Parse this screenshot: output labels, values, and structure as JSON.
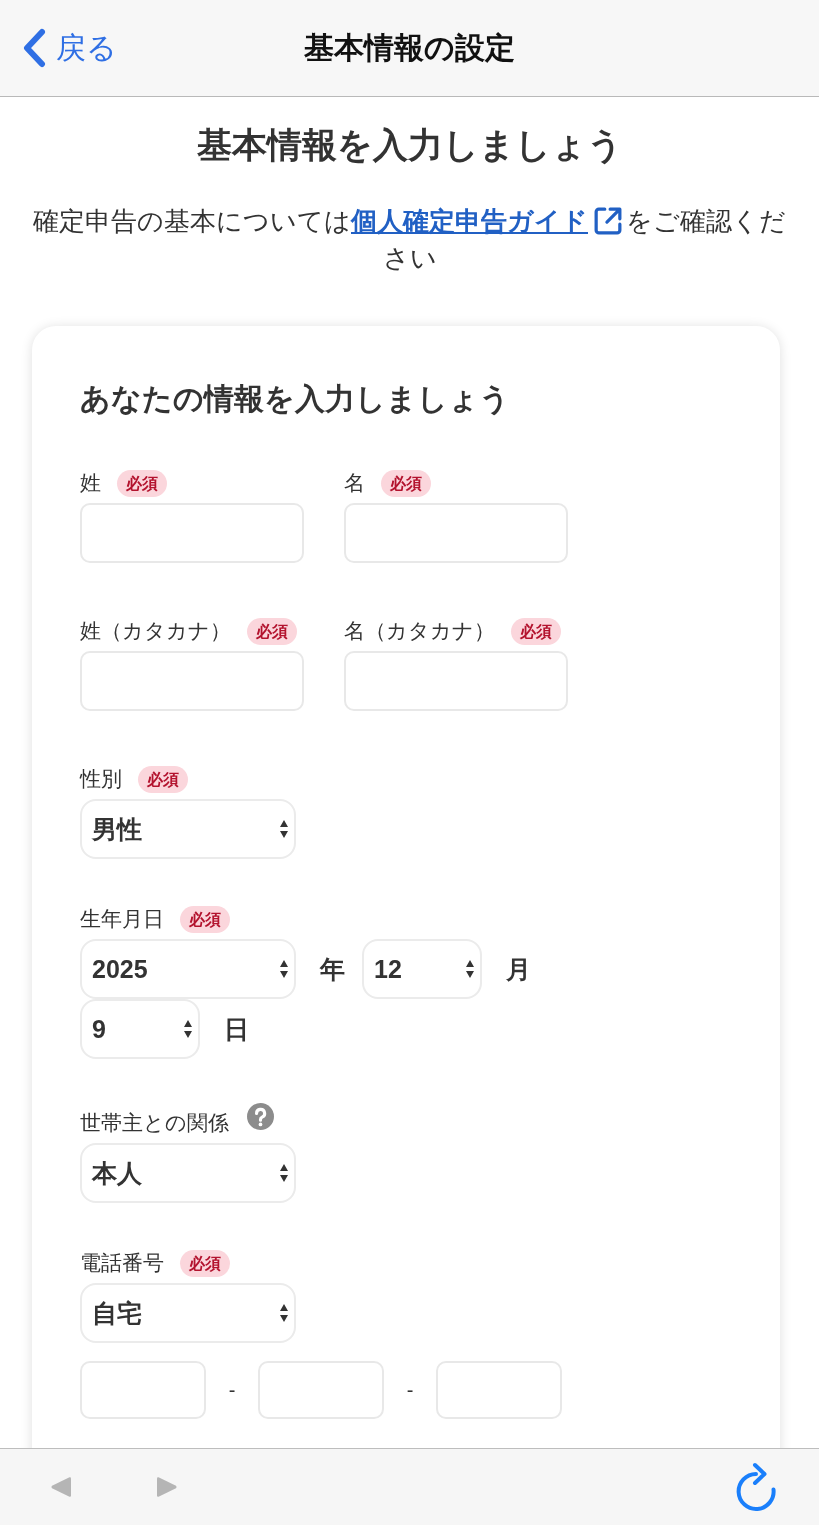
{
  "nav_bar": {
    "back_label": "戻る",
    "title": "基本情報の設定"
  },
  "heading": "基本情報を入力しましょう",
  "intro": {
    "text_before": "確定申告の基本については",
    "link": "個人確定申告ガイド",
    "text_after": "をご確認ください"
  },
  "card": {
    "title": "あなたの情報を入力しましょう",
    "fields": [
      {
        "kind": "text_pair",
        "items": [
          {
            "label": "姓",
            "badge": "必須",
            "help": false
          },
          {
            "label": "名",
            "badge": "必須",
            "help": false
          }
        ]
      },
      {
        "kind": "text_pair",
        "items": [
          {
            "label": "姓（カタカナ）",
            "badge": "必須",
            "help": false
          },
          {
            "label": "名（カタカナ）",
            "badge": "必須",
            "help": false
          }
        ]
      },
      {
        "kind": "select",
        "label": "性別",
        "badge": "必須",
        "help": false,
        "value": "男性"
      },
      {
        "kind": "date",
        "label": "生年月日",
        "badge": "必須",
        "help": false,
        "parts": [
          {
            "value": "2025",
            "unit": "年"
          },
          {
            "value": "12",
            "unit": "月"
          },
          {
            "value": "9",
            "unit": "日"
          }
        ]
      },
      {
        "kind": "select",
        "label": "世帯主との関係",
        "help": true,
        "value": "本人"
      },
      {
        "kind": "phone",
        "label": "電話番号",
        "badge": "必須",
        "help": false,
        "value": "自宅",
        "separators": [
          "-",
          "-"
        ]
      }
    ]
  },
  "toolbar": {
    "back": {
      "disabled": true
    },
    "forward": {
      "disabled": true
    }
  }
}
